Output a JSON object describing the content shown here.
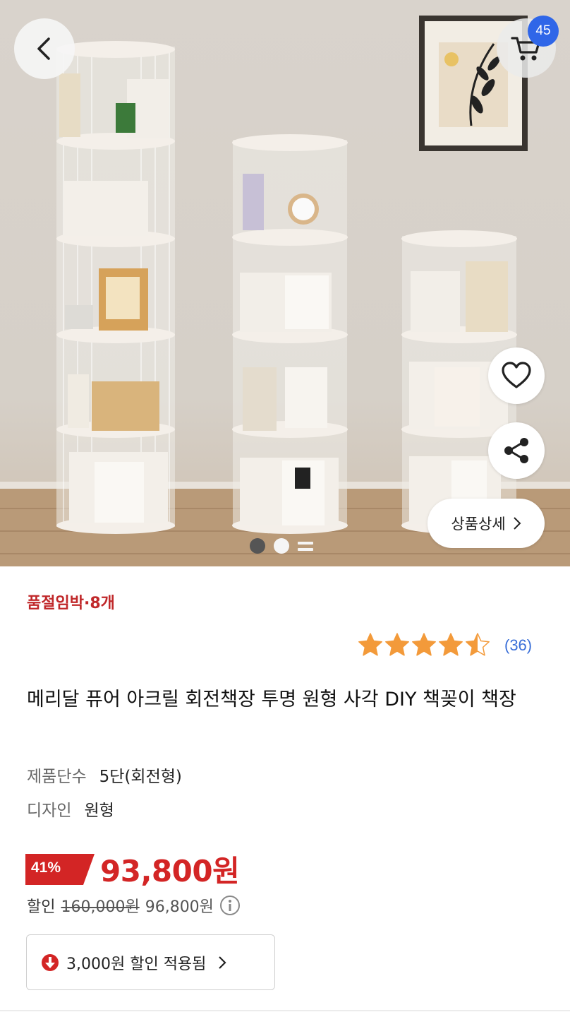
{
  "header": {
    "cart_count": "45"
  },
  "gallery": {
    "detail_label": "상품상세"
  },
  "product": {
    "stock_notice": "품절임박·8개",
    "rating_count": "(36)",
    "rating_value": 4.5,
    "title": "메리달 퓨어 아크릴 회전책장 투명 원형 사각 DIY 책꽂이 책장",
    "options": [
      {
        "key": "제품단수",
        "value": "5단(회전형)"
      },
      {
        "key": "디자인",
        "value": "원형"
      }
    ],
    "discount_rate": "41%",
    "sale_price": "93,800원",
    "discount_label": "할인",
    "original_price": "160,000원",
    "other_price": "96,800원",
    "coupon_text": "3,000원 할인 적용됨"
  },
  "colors": {
    "accent_red": "#d32525",
    "stock_red": "#c0282a",
    "rating_blue": "#3a6fd8",
    "badge_blue": "#2f66e8",
    "star_orange": "#f39a3a"
  },
  "icons": [
    "back-arrow-icon",
    "cart-icon",
    "heart-icon",
    "share-icon",
    "chevron-right-icon",
    "info-icon",
    "coupon-down-icon"
  ]
}
